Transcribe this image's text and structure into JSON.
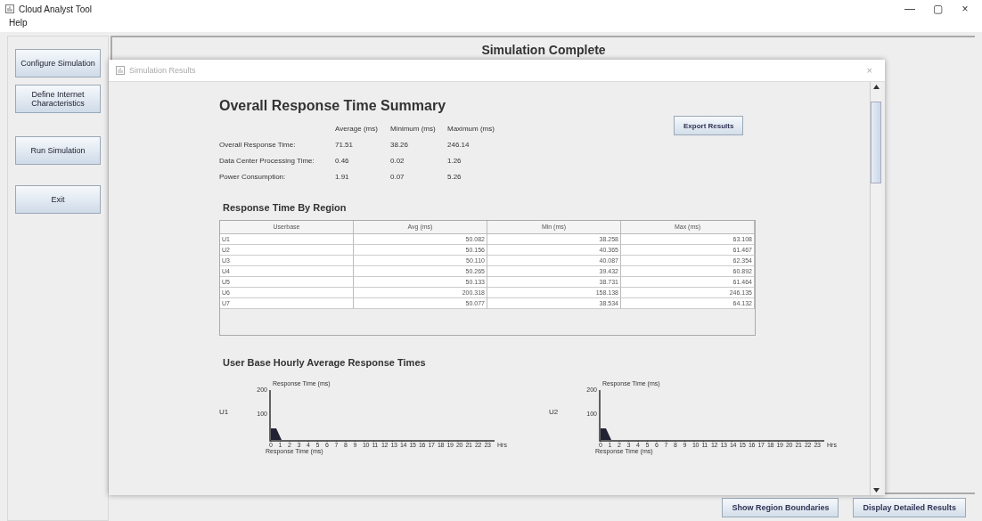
{
  "window": {
    "title": "Cloud Analyst Tool",
    "controls": [
      "—",
      "▢",
      "×"
    ]
  },
  "menu": [
    "Help"
  ],
  "sidebar": {
    "buttons": [
      {
        "label": "Configure Simulation"
      },
      {
        "label": "Define Internet Characteristics"
      },
      {
        "label": "Run Simulation"
      },
      {
        "label": "Exit"
      }
    ]
  },
  "main": {
    "heading": "Simulation Complete"
  },
  "dialog": {
    "title": "Simulation Results",
    "close": "×",
    "summary": {
      "title": "Overall Response Time Summary",
      "columns": [
        "Average (ms)",
        "Minimum (ms)",
        "Maximum (ms)"
      ],
      "rows": [
        {
          "label": "Overall Response Time:",
          "values": [
            "71.51",
            "38.26",
            "246.14"
          ]
        },
        {
          "label": "Data Center Processing Time:",
          "values": [
            "0.46",
            "0.02",
            "1.26"
          ]
        },
        {
          "label": "Power Consumption:",
          "values": [
            "1.91",
            "0.07",
            "5.26"
          ]
        }
      ],
      "export": "Export Results"
    },
    "region": {
      "title": "Response Time By Region",
      "columns": [
        "Userbase",
        "Avg (ms)",
        "Min (ms)",
        "Max (ms)"
      ],
      "rows": [
        [
          "U1",
          "50.082",
          "38.258",
          "63.108"
        ],
        [
          "U2",
          "50.156",
          "40.365",
          "61.467"
        ],
        [
          "U3",
          "50.110",
          "40.087",
          "62.354"
        ],
        [
          "U4",
          "50.265",
          "39.432",
          "60.892"
        ],
        [
          "U5",
          "50.133",
          "38.731",
          "61.464"
        ],
        [
          "U6",
          "200.318",
          "158.138",
          "246.135"
        ],
        [
          "U7",
          "50.077",
          "38.534",
          "64.132"
        ]
      ]
    },
    "hourly": {
      "title": "User Base Hourly Average Response Times",
      "charts": [
        {
          "name": "U1",
          "ylabel": "Response Time (ms)",
          "yticks": [
            "200",
            "100"
          ],
          "xticks": [
            "0",
            "1",
            "2",
            "3",
            "4",
            "5",
            "6",
            "7",
            "8",
            "9",
            "10",
            "11",
            "12",
            "13",
            "14",
            "15",
            "16",
            "17",
            "18",
            "19",
            "20",
            "21",
            "22",
            "23"
          ],
          "xlabel": "Hrs"
        },
        {
          "name": "U2",
          "ylabel": "Response Time (ms)",
          "yticks": [
            "200",
            "100"
          ],
          "xticks": [
            "0",
            "1",
            "2",
            "3",
            "4",
            "5",
            "6",
            "7",
            "8",
            "9",
            "10",
            "11",
            "12",
            "13",
            "14",
            "15",
            "16",
            "17",
            "18",
            "19",
            "20",
            "21",
            "22",
            "23"
          ],
          "xlabel": "Hrs"
        }
      ],
      "next_labels": [
        "Response Time (ms)",
        "Response Time (ms)"
      ]
    }
  },
  "footer": {
    "buttons": [
      "Show Region Boundaries",
      "Display Detailed Results"
    ]
  }
}
